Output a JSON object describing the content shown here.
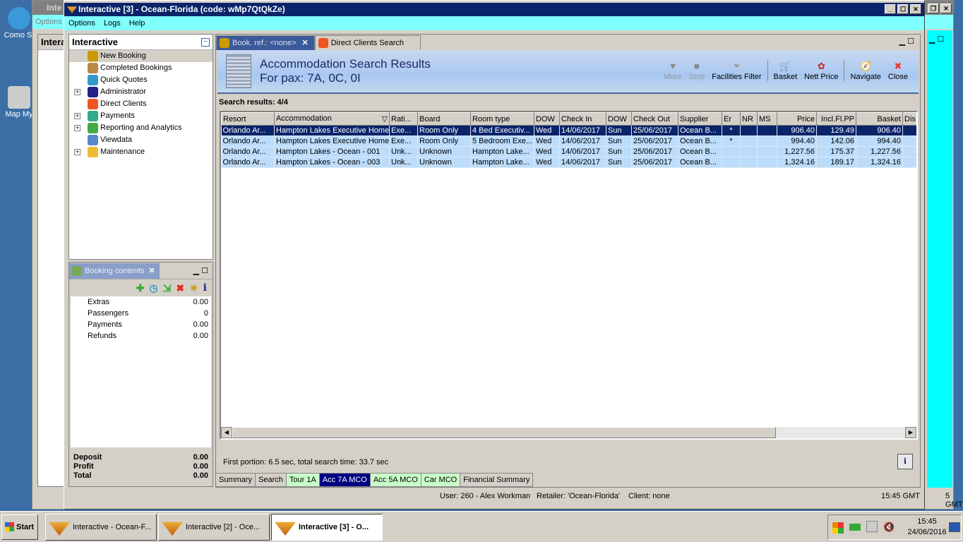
{
  "desktop": {
    "icons": [
      {
        "label": "Como St"
      },
      {
        "label": "Map My"
      }
    ]
  },
  "back_window": {
    "title": "Inte",
    "menu": "Options",
    "panel_title": "Intera",
    "status_time": "5 GMT"
  },
  "window": {
    "title": "Interactive [3] - Ocean-Florida (code: wMp7QtQkZe)",
    "menu": [
      "Options",
      "Logs",
      "Help"
    ]
  },
  "nav": {
    "title": "Interactive",
    "items": [
      {
        "label": "New Booking",
        "expandable": false,
        "selected": true,
        "icon": "palm-tree-icon"
      },
      {
        "label": "Completed Bookings",
        "expandable": false,
        "icon": "palm-money-icon"
      },
      {
        "label": "Quick Quotes",
        "expandable": false,
        "icon": "clock-icon"
      },
      {
        "label": "Administrator",
        "expandable": true,
        "icon": "runner-icon"
      },
      {
        "label": "Direct Clients",
        "expandable": false,
        "icon": "person-icon"
      },
      {
        "label": "Payments",
        "expandable": true,
        "icon": "dollar-icon"
      },
      {
        "label": "Reporting and Analytics",
        "expandable": true,
        "icon": "report-icon"
      },
      {
        "label": "Viewdata",
        "expandable": false,
        "icon": "globe-icon"
      },
      {
        "label": "Maintenance",
        "expandable": true,
        "icon": "tools-icon"
      }
    ]
  },
  "booking_contents": {
    "title": "Booking contents",
    "rows": [
      {
        "label": "Extras",
        "value": "0.00"
      },
      {
        "label": "Passengers",
        "value": "0"
      },
      {
        "label": "Payments",
        "value": "0.00"
      },
      {
        "label": "Refunds",
        "value": "0.00"
      }
    ],
    "totals": [
      {
        "label": "Deposit",
        "value": "0.00"
      },
      {
        "label": "Profit",
        "value": "0.00"
      },
      {
        "label": "Total",
        "value": "0.00"
      }
    ]
  },
  "tabs": [
    {
      "label": "Book. ref.: <none>",
      "active": true
    },
    {
      "label": "Direct Clients Search",
      "active": false
    }
  ],
  "header": {
    "title": "Accommodation Search Results",
    "subtitle": "For pax: 7A, 0C, 0I"
  },
  "toolbar": [
    {
      "label": "More",
      "disabled": true,
      "icon": "▼"
    },
    {
      "label": "Stop",
      "disabled": true,
      "icon": "■"
    },
    {
      "label": "Facilities Filter",
      "icon": "⏷"
    },
    {
      "sep": true
    },
    {
      "label": "Basket",
      "icon": "🛒"
    },
    {
      "label": "Nett Price",
      "icon": "✿"
    },
    {
      "sep": true
    },
    {
      "label": "Navigate",
      "icon": "🧭"
    },
    {
      "label": "Close",
      "icon": "✖"
    }
  ],
  "results": {
    "label": "Search results: 4/4",
    "columns": [
      "Resort",
      "Accommodation",
      "Rati...",
      "Board",
      "Room type",
      "DOW",
      "Check In",
      "DOW",
      "Check Out",
      "Supplier",
      "Er",
      "NR",
      "MS",
      "Price",
      "Incl.Fl.PP",
      "Basket",
      "Dis"
    ],
    "rows": [
      [
        "Orlando Ar...",
        "Hampton Lakes Executive Homes",
        "Exe...",
        "Room Only",
        "4 Bed Executiv...",
        "Wed",
        "14/06/2017",
        "Sun",
        "25/06/2017",
        "Ocean B...",
        "*",
        "",
        "",
        "906.40",
        "129.49",
        "906.40",
        ""
      ],
      [
        "Orlando Ar...",
        "Hampton Lakes Executive Homes",
        "Exe...",
        "Room Only",
        "5 Bedroom Exe...",
        "Wed",
        "14/06/2017",
        "Sun",
        "25/06/2017",
        "Ocean B...",
        "*",
        "",
        "",
        "994.40",
        "142.06",
        "994.40",
        ""
      ],
      [
        "Orlando Ar...",
        "Hampton Lakes - Ocean - 001",
        "Unk...",
        "Unknown",
        "Hampton Lake...",
        "Wed",
        "14/06/2017",
        "Sun",
        "25/06/2017",
        "Ocean B...",
        "",
        "",
        "",
        "1,227.56",
        "175.37",
        "1,227.56",
        ""
      ],
      [
        "Orlando Ar...",
        "Hampton Lakes - Ocean - 003",
        "Unk...",
        "Unknown",
        "Hampton Lake...",
        "Wed",
        "14/06/2017",
        "Sun",
        "25/06/2017",
        "Ocean B...",
        "",
        "",
        "",
        "1,324.16",
        "189.17",
        "1,324.16",
        ""
      ]
    ],
    "selected_row": 0
  },
  "timing": "First portion: 6.5 sec, total search time: 33.7 sec",
  "bottom_tabs": [
    {
      "label": "Summary",
      "style": "plain"
    },
    {
      "label": "Search",
      "style": "plain"
    },
    {
      "label": "Tour 1A",
      "style": "green"
    },
    {
      "label": "Acc 7A MCO",
      "style": "active"
    },
    {
      "label": "Acc 5A MCO",
      "style": "green"
    },
    {
      "label": "Car MCO",
      "style": "green"
    },
    {
      "label": "Financial Summary",
      "style": "plain"
    }
  ],
  "status": {
    "user": "User: 260 - Alex Workman",
    "retailer": "Retailer: 'Ocean-Florida'",
    "client": "Client: none",
    "time": "15:45 GMT"
  },
  "taskbar": {
    "start": "Start",
    "tasks": [
      "Interactive - Ocean-F...",
      "Interactive [2] - Oce...",
      "Interactive [3] - O..."
    ],
    "active_task": 2,
    "clock_time": "15:45",
    "clock_date": "24/06/2016"
  }
}
